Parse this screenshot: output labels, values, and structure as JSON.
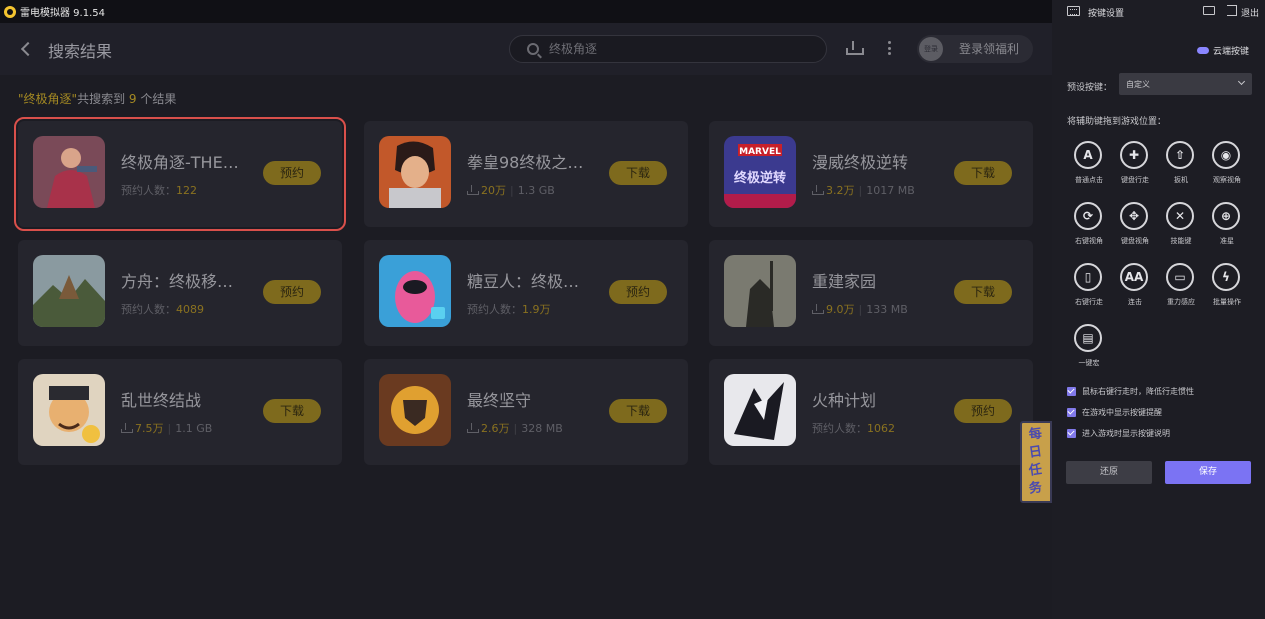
{
  "titlebar": {
    "title": "雷电模拟器 9.1.54"
  },
  "header": {
    "title": "搜索结果",
    "search_value": "终极角逐",
    "login_avatar_label": "登录",
    "login_label": "登录领福利"
  },
  "summary": {
    "prefix": "\"",
    "keyword": "终极角逐",
    "middle": "\"共搜索到 ",
    "count": "9",
    "suffix": " 个结果"
  },
  "games": [
    {
      "name": "终极角逐-THE…",
      "mode": "reserve",
      "meta_label": "预约人数：",
      "meta_value": "122",
      "button": "预约",
      "icon": "hero-art"
    },
    {
      "name": "拳皇98终极之…",
      "mode": "download",
      "downloads": "20万",
      "size": "1.3 GB",
      "button": "下载",
      "icon": "fighter-art"
    },
    {
      "name": "漫威终极逆转",
      "mode": "download",
      "downloads": "3.2万",
      "size": "1017 MB",
      "button": "下载",
      "icon": "marvel-art"
    },
    {
      "name": "方舟：终极移…",
      "mode": "reserve",
      "meta_label": "预约人数：",
      "meta_value": "4089",
      "button": "预约",
      "icon": "ark-art"
    },
    {
      "name": "糖豆人：终极…",
      "mode": "reserve",
      "meta_label": "预约人数：",
      "meta_value": "1.9万",
      "button": "预约",
      "icon": "fallguys-art"
    },
    {
      "name": "重建家园",
      "mode": "download",
      "downloads": "9.0万",
      "size": "133 MB",
      "button": "下载",
      "icon": "warrior-art"
    },
    {
      "name": "乱世终结战",
      "mode": "download",
      "downloads": "7.5万",
      "size": "1.1 GB",
      "button": "下载",
      "icon": "general-art"
    },
    {
      "name": "最终坚守",
      "mode": "download",
      "downloads": "2.6万",
      "size": "328 MB",
      "button": "下载",
      "icon": "shield-art"
    },
    {
      "name": "火种计划",
      "mode": "reserve",
      "meta_label": "预约人数：",
      "meta_value": "1062",
      "button": "预约",
      "icon": "anime-art"
    }
  ],
  "icon_text": {
    "marvel_brand": "MARVEL",
    "marvel_title": "终极逆转"
  },
  "daily_task": [
    "每",
    "日",
    "任",
    "务"
  ],
  "panel": {
    "title": "按键设置",
    "exit": "退出",
    "cloud": "云端按键",
    "preset_label": "预设按键：",
    "preset_value": "自定义",
    "drag_hint": "将辅助键拖到游戏位置：",
    "tools": [
      {
        "glyph": "A",
        "label": "普通点击",
        "icon": "tap-icon"
      },
      {
        "glyph": "✚",
        "label": "键盘行走",
        "icon": "dpad-icon"
      },
      {
        "glyph": "⇧",
        "label": "扳机",
        "icon": "trigger-icon"
      },
      {
        "glyph": "◉",
        "label": "观察视角",
        "icon": "eye-icon"
      },
      {
        "glyph": "⟳",
        "label": "右键视角",
        "icon": "right-view-icon"
      },
      {
        "glyph": "✥",
        "label": "键盘视角",
        "icon": "keyboard-view-icon"
      },
      {
        "glyph": "✕",
        "label": "技能键",
        "icon": "skill-icon"
      },
      {
        "glyph": "⊕",
        "label": "准星",
        "icon": "crosshair-icon"
      },
      {
        "glyph": "▯",
        "label": "右键行走",
        "icon": "mouse-icon"
      },
      {
        "glyph": "AA",
        "label": "连击",
        "icon": "combo-icon"
      },
      {
        "glyph": "▭",
        "label": "重力感应",
        "icon": "gravity-icon"
      },
      {
        "glyph": "ϟ",
        "label": "批量操作",
        "icon": "batch-icon"
      },
      {
        "glyph": "▤",
        "label": "一键宏",
        "icon": "macro-icon"
      }
    ],
    "checkboxes": [
      "鼠标右键行走时，降低行走惯性",
      "在游戏中显示按键提醒",
      "进入游戏时显示按键说明"
    ],
    "restore": "还原",
    "save": "保存"
  },
  "colors": {
    "accent_gold": "#a58a23",
    "accent_purple": "#7b73f3",
    "highlight_red": "#d9504b"
  }
}
